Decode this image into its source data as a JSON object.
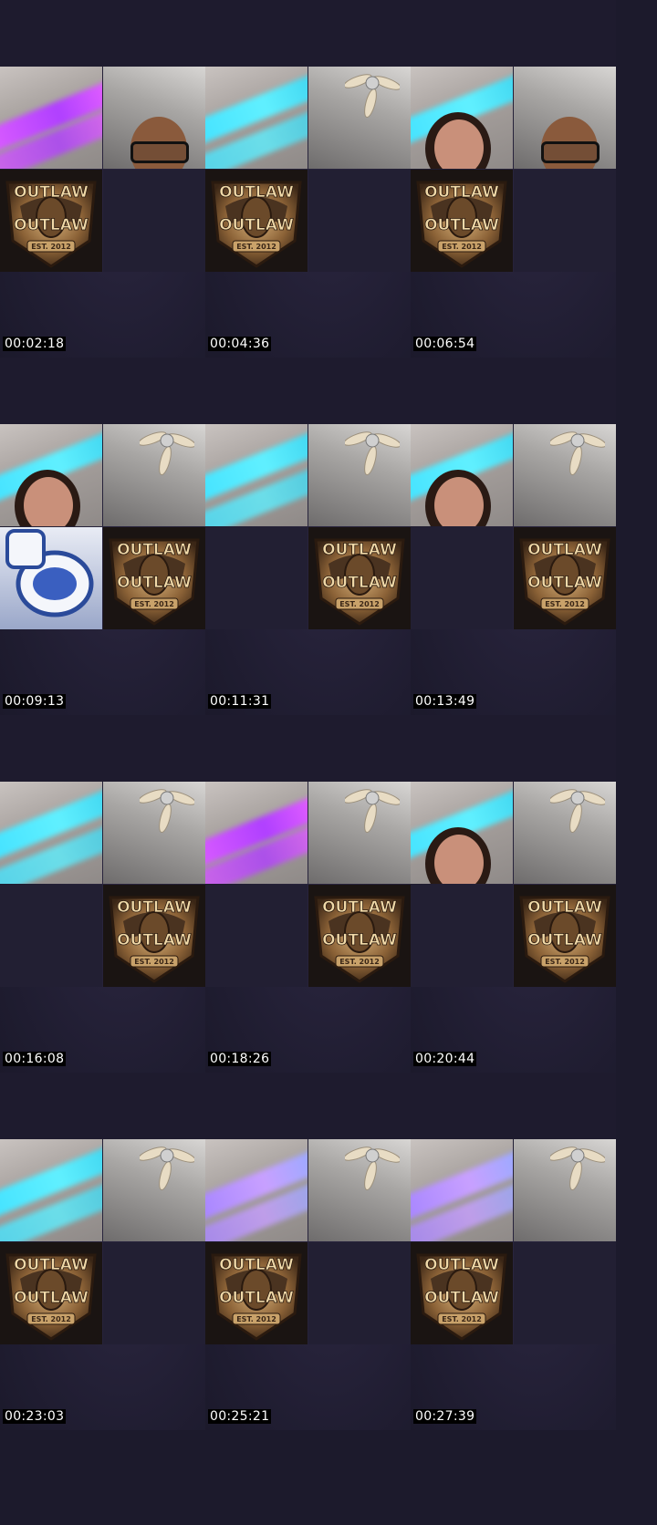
{
  "frames": [
    {
      "timestamp": "00:02:18",
      "tiles": {
        "tl": "ceiling-pink",
        "tr": "man-glasses",
        "bl": "outlaw-badge",
        "br": "empty"
      }
    },
    {
      "timestamp": "00:04:36",
      "tiles": {
        "tl": "ceiling-cyan",
        "tr": "ceiling-fan",
        "bl": "outlaw-badge",
        "br": "empty"
      }
    },
    {
      "timestamp": "00:06:54",
      "tiles": {
        "tl": "woman-face",
        "tr": "man-glasses",
        "bl": "outlaw-badge",
        "br": "empty"
      }
    },
    {
      "timestamp": "00:09:13",
      "tiles": {
        "tl": "woman-face",
        "tr": "ceiling-fan",
        "bl": "toilet",
        "br": "outlaw-badge"
      }
    },
    {
      "timestamp": "00:11:31",
      "tiles": {
        "tl": "ceiling-cyan",
        "tr": "ceiling-fan",
        "bl": "empty",
        "br": "outlaw-badge"
      }
    },
    {
      "timestamp": "00:13:49",
      "tiles": {
        "tl": "woman-face",
        "tr": "ceiling-fan",
        "bl": "empty",
        "br": "outlaw-badge"
      }
    },
    {
      "timestamp": "00:16:08",
      "tiles": {
        "tl": "ceiling-cyan",
        "tr": "ceiling-fan",
        "bl": "empty",
        "br": "outlaw-badge"
      }
    },
    {
      "timestamp": "00:18:26",
      "tiles": {
        "tl": "ceiling-pink",
        "tr": "ceiling-fan",
        "bl": "empty",
        "br": "outlaw-badge"
      }
    },
    {
      "timestamp": "00:20:44",
      "tiles": {
        "tl": "woman-face",
        "tr": "ceiling-fan",
        "bl": "empty",
        "br": "outlaw-badge"
      }
    },
    {
      "timestamp": "00:23:03",
      "tiles": {
        "tl": "ceiling-cyan",
        "tr": "ceiling-fan",
        "bl": "outlaw-badge",
        "br": "empty"
      }
    },
    {
      "timestamp": "00:25:21",
      "tiles": {
        "tl": "ceiling-purple",
        "tr": "ceiling-fan",
        "bl": "outlaw-badge",
        "br": "empty"
      }
    },
    {
      "timestamp": "00:27:39",
      "tiles": {
        "tl": "ceiling-purple",
        "tr": "ceiling-fan",
        "bl": "outlaw-badge",
        "br": "empty"
      }
    }
  ],
  "badge": {
    "line1": "OUTLAW",
    "line2": "OUTLAW",
    "est": "EST. 2012"
  },
  "colors": {
    "background": "#1c1a2c",
    "timestamp_bg": "#000000",
    "timestamp_fg": "#ffffff"
  }
}
